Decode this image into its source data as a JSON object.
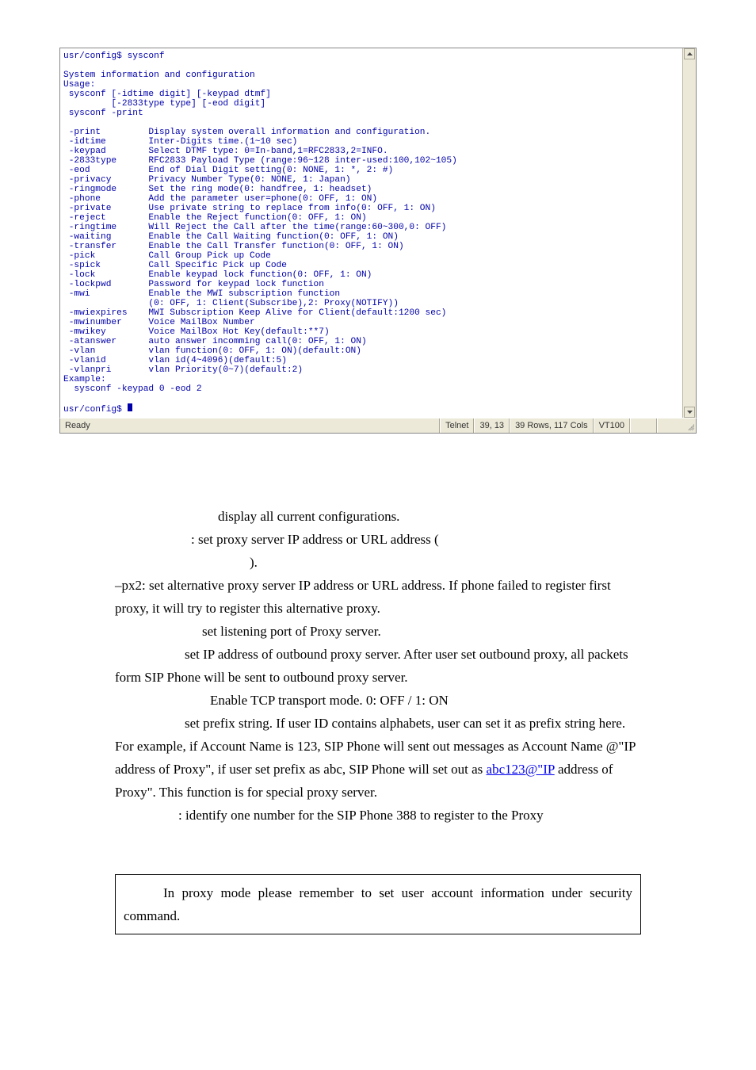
{
  "terminal": {
    "prompt1": "usr/config$ sysconf",
    "header": "System information and configuration",
    "usage_label": "Usage:",
    "usage_line1": " sysconf [-idtime digit] [-keypad dtmf]",
    "usage_line2": "         [-2833type type] [-eod digit]",
    "usage_line3": " sysconf -print",
    "options": [
      {
        "flag": " -print",
        "desc": "Display system overall information and configuration."
      },
      {
        "flag": " -idtime",
        "desc": "Inter-Digits time.(1~10 sec)"
      },
      {
        "flag": " -keypad",
        "desc": "Select DTMF type: 0=In-band,1=RFC2833,2=INFO."
      },
      {
        "flag": " -2833type",
        "desc": "RFC2833 Payload Type (range:96~128 inter-used:100,102~105)"
      },
      {
        "flag": " -eod",
        "desc": "End of Dial Digit setting(0: NONE, 1: *, 2: #)"
      },
      {
        "flag": " -privacy",
        "desc": "Privacy Number Type(0: NONE, 1: Japan)"
      },
      {
        "flag": " -ringmode",
        "desc": "Set the ring mode(0: handfree, 1: headset)"
      },
      {
        "flag": " -phone",
        "desc": "Add the parameter user=phone(0: OFF, 1: ON)"
      },
      {
        "flag": " -private",
        "desc": "Use private string to replace from info(0: OFF, 1: ON)"
      },
      {
        "flag": " -reject",
        "desc": "Enable the Reject function(0: OFF, 1: ON)"
      },
      {
        "flag": " -ringtime",
        "desc": "Will Reject the Call after the time(range:60~300,0: OFF)"
      },
      {
        "flag": " -waiting",
        "desc": "Enable the Call Waiting function(0: OFF, 1: ON)"
      },
      {
        "flag": " -transfer",
        "desc": "Enable the Call Transfer function(0: OFF, 1: ON)"
      },
      {
        "flag": " -pick",
        "desc": "Call Group Pick up Code"
      },
      {
        "flag": " -spick",
        "desc": "Call Specific Pick up Code"
      },
      {
        "flag": " -lock",
        "desc": "Enable keypad lock function(0: OFF, 1: ON)"
      },
      {
        "flag": " -lockpwd",
        "desc": "Password for keypad lock function"
      },
      {
        "flag": " -mwi",
        "desc": "Enable the MWI subscription function"
      },
      {
        "flag": "",
        "desc": "(0: OFF, 1: Client(Subscribe),2: Proxy(NOTIFY))"
      },
      {
        "flag": " -mwiexpires",
        "desc": "MWI Subscription Keep Alive for Client(default:1200 sec)"
      },
      {
        "flag": " -mwinumber",
        "desc": "Voice MailBox Number"
      },
      {
        "flag": " -mwikey",
        "desc": "Voice MailBox Hot Key(default:**7)"
      },
      {
        "flag": " -atanswer",
        "desc": "auto answer incomming call(0: OFF, 1: ON)"
      },
      {
        "flag": " -vlan",
        "desc": "vlan function(0: OFF, 1: ON)(default:ON)"
      },
      {
        "flag": " -vlanid",
        "desc": "vlan id(4~4096)(default:5)"
      },
      {
        "flag": " -vlanpri",
        "desc": "vlan Priority(0~7)(default:2)"
      }
    ],
    "example_label": "Example:",
    "example_line": "  sysconf -keypad 0 -eod 2",
    "prompt2_prefix": "usr/config$ "
  },
  "status": {
    "ready": "Ready",
    "proto": "Telnet",
    "pos": "39, 13",
    "dims": "39 Rows, 117 Cols",
    "term": "VT100"
  },
  "doc": {
    "p1": "display all current configurations.",
    "p2": ": set proxy server IP address or URL address (",
    "p3": ").",
    "p4": "–px2: set alternative proxy server IP address or URL address. If phone failed to register first proxy, it will try to register this alternative proxy.",
    "p5": "set listening port of Proxy server.",
    "p6": "set IP address of outbound proxy server. After user set outbound proxy, all packets form SIP Phone will be sent to outbound proxy server.",
    "p7": "Enable TCP transport mode. 0: OFF / 1: ON",
    "p8a": "set prefix string. If user ID contains alphabets, user can set it as prefix string here. For example, if Account Name is 123, SIP Phone will sent out messages as Account Name @\"IP address of Proxy\", if user set prefix as abc, SIP Phone will set out as ",
    "p8link": "abc123@\"IP",
    "p8b": " address of Proxy\". This function is for special proxy server.",
    "p9": ": identify one number for the SIP Phone 388 to register to the Proxy",
    "note": "In proxy mode please remember to set user account information under security command."
  }
}
